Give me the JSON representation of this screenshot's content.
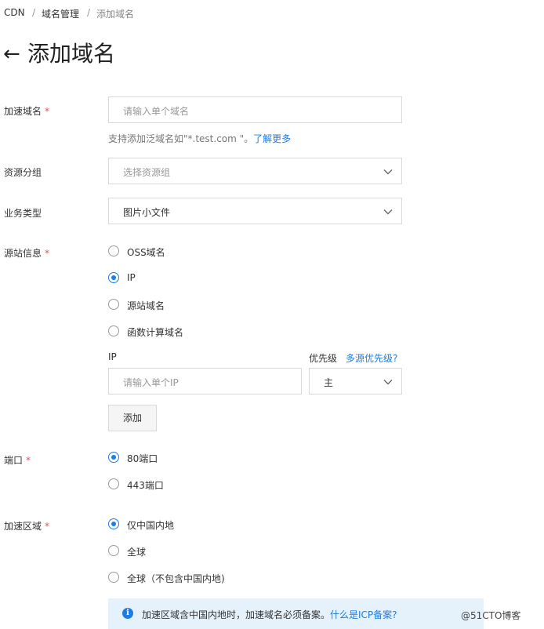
{
  "breadcrumb": {
    "items": [
      "CDN",
      "域名管理",
      "添加域名"
    ],
    "separator": "/"
  },
  "header": {
    "back_icon": "←",
    "title": "添加域名"
  },
  "required_mark": "*",
  "domain": {
    "label": "加速域名",
    "placeholder": "请输入单个域名",
    "hint": "支持添加泛域名如\"*.test.com \"。",
    "hint_link": "了解更多"
  },
  "resource_group": {
    "label": "资源分组",
    "placeholder": "选择资源组"
  },
  "business_type": {
    "label": "业务类型",
    "value": "图片小文件"
  },
  "origin": {
    "label": "源站信息",
    "options": [
      "OSS域名",
      "IP",
      "源站域名",
      "函数计算域名"
    ],
    "selected": "IP",
    "ip_label": "IP",
    "priority_label": "优先级",
    "priority_link": "多源优先级?",
    "ip_placeholder": "请输入单个IP",
    "priority_value": "主",
    "add_button": "添加"
  },
  "port": {
    "label": "端口",
    "options": [
      "80端口",
      "443端口"
    ],
    "selected": "80端口"
  },
  "region": {
    "label": "加速区域",
    "options": [
      "仅中国内地",
      "全球",
      "全球（不包含中国内地)"
    ],
    "selected": "仅中国内地",
    "notice": "加速区域含中国内地时，加速域名必须备案。",
    "notice_link": "什么是ICP备案?",
    "info_icon": "i"
  },
  "watermark": "@51CTO博客",
  "colors": {
    "accent": "#1f7ce0",
    "required": "#e0505f",
    "info_bg": "#e6f2fb",
    "border": "#d9d9d9"
  }
}
